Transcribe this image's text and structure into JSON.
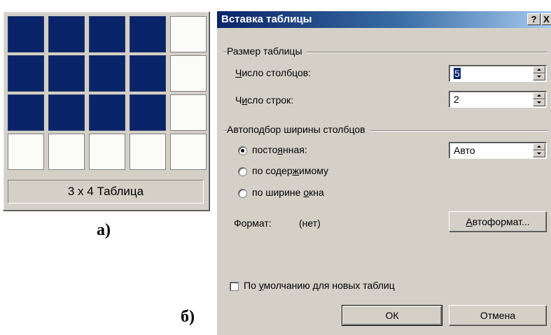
{
  "grid_picker": {
    "rows": 4,
    "cols": 5,
    "selected_rows": 3,
    "selected_cols": 4,
    "caption": "3 x 4 Таблица",
    "panel_label": "а)"
  },
  "dialog": {
    "panel_label": "б)",
    "title": "Вставка таблицы",
    "help_btn": "?",
    "close_btn": "X",
    "size_group": "Размер таблицы",
    "columns": {
      "label_u": "Ч",
      "label_rest": "исло столбцов:",
      "value": "5"
    },
    "rows": {
      "label_pre": "Ч",
      "label_u": "и",
      "label_rest": "сло строк:",
      "value": "2"
    },
    "autofit_group": "Автоподбор ширины столбцов",
    "fixed": {
      "pre": "посто",
      "u": "я",
      "rest": "нная:",
      "value": "Авто"
    },
    "contents": {
      "pre": "по содер",
      "u": "ж",
      "rest": "имому"
    },
    "window": {
      "pre": "по ширине ",
      "u": "о",
      "rest": "кна"
    },
    "format_label": "Формат:",
    "format_value": "(нет)",
    "autoformat": {
      "u": "А",
      "rest": "втоформат..."
    },
    "default_check": {
      "pre": "По ",
      "u": "у",
      "rest": "молчанию для новых таблиц"
    },
    "ok": "ОК",
    "cancel": "Отмена"
  }
}
